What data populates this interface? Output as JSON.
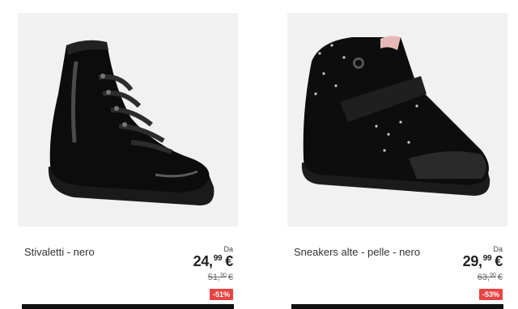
{
  "products": [
    {
      "name": "Stivaletti - nero",
      "from_label": "Da",
      "price_int": "24,",
      "price_dec": "99",
      "currency": "€",
      "old_price_int": "51,",
      "old_price_dec": "90",
      "old_currency": "€",
      "discount": "-51%",
      "image_icon": "black-patent-ankle-boot",
      "discount_color": "#e74444"
    },
    {
      "name": "Sneakers alte - pelle - nero",
      "from_label": "Da",
      "price_int": "29,",
      "price_dec": "99",
      "currency": "€",
      "old_price_int": "63,",
      "old_price_dec": "90",
      "old_currency": "€",
      "discount": "-53%",
      "image_icon": "black-high-top-sneaker",
      "discount_color": "#e74444"
    }
  ]
}
